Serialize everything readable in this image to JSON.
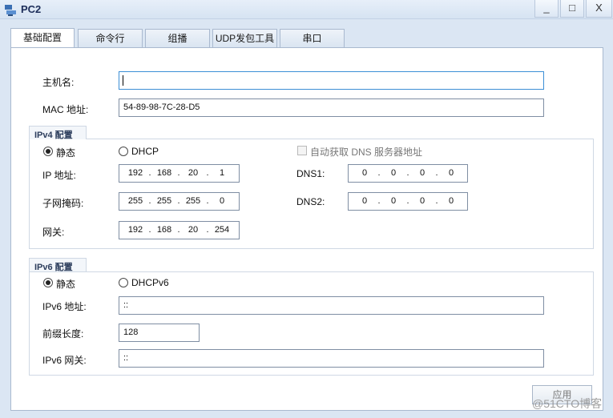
{
  "window": {
    "title": "PC2",
    "minimize": "_",
    "maximize": "□",
    "close": "X"
  },
  "tabs": [
    {
      "label": "基础配置"
    },
    {
      "label": "命令行"
    },
    {
      "label": "组播"
    },
    {
      "label": "UDP发包工具"
    },
    {
      "label": "串口"
    }
  ],
  "basic": {
    "hostname_label": "主机名:",
    "hostname_value": "",
    "mac_label": "MAC 地址:",
    "mac_value": "54-89-98-7C-28-D5"
  },
  "ipv4": {
    "title": "IPv4 配置",
    "static_label": "静态",
    "dhcp_label": "DHCP",
    "auto_dns_label": "自动获取 DNS 服务器地址",
    "ip_label": "IP 地址:",
    "ip": [
      "192",
      "168",
      "20",
      "1"
    ],
    "mask_label": "子网掩码:",
    "mask": [
      "255",
      "255",
      "255",
      "0"
    ],
    "gateway_label": "网关:",
    "gateway": [
      "192",
      "168",
      "20",
      "254"
    ],
    "dns1_label": "DNS1:",
    "dns1": [
      "0",
      "0",
      "0",
      "0"
    ],
    "dns2_label": "DNS2:",
    "dns2": [
      "0",
      "0",
      "0",
      "0"
    ]
  },
  "ipv6": {
    "title": "IPv6 配置",
    "static_label": "静态",
    "dhcp_label": "DHCPv6",
    "addr_label": "IPv6 地址:",
    "addr_value": "::",
    "prefix_label": "前缀长度:",
    "prefix_value": "128",
    "gateway_label": "IPv6 网关:",
    "gateway_value": "::"
  },
  "apply_label": "应用",
  "watermark": "@51CTO博客"
}
